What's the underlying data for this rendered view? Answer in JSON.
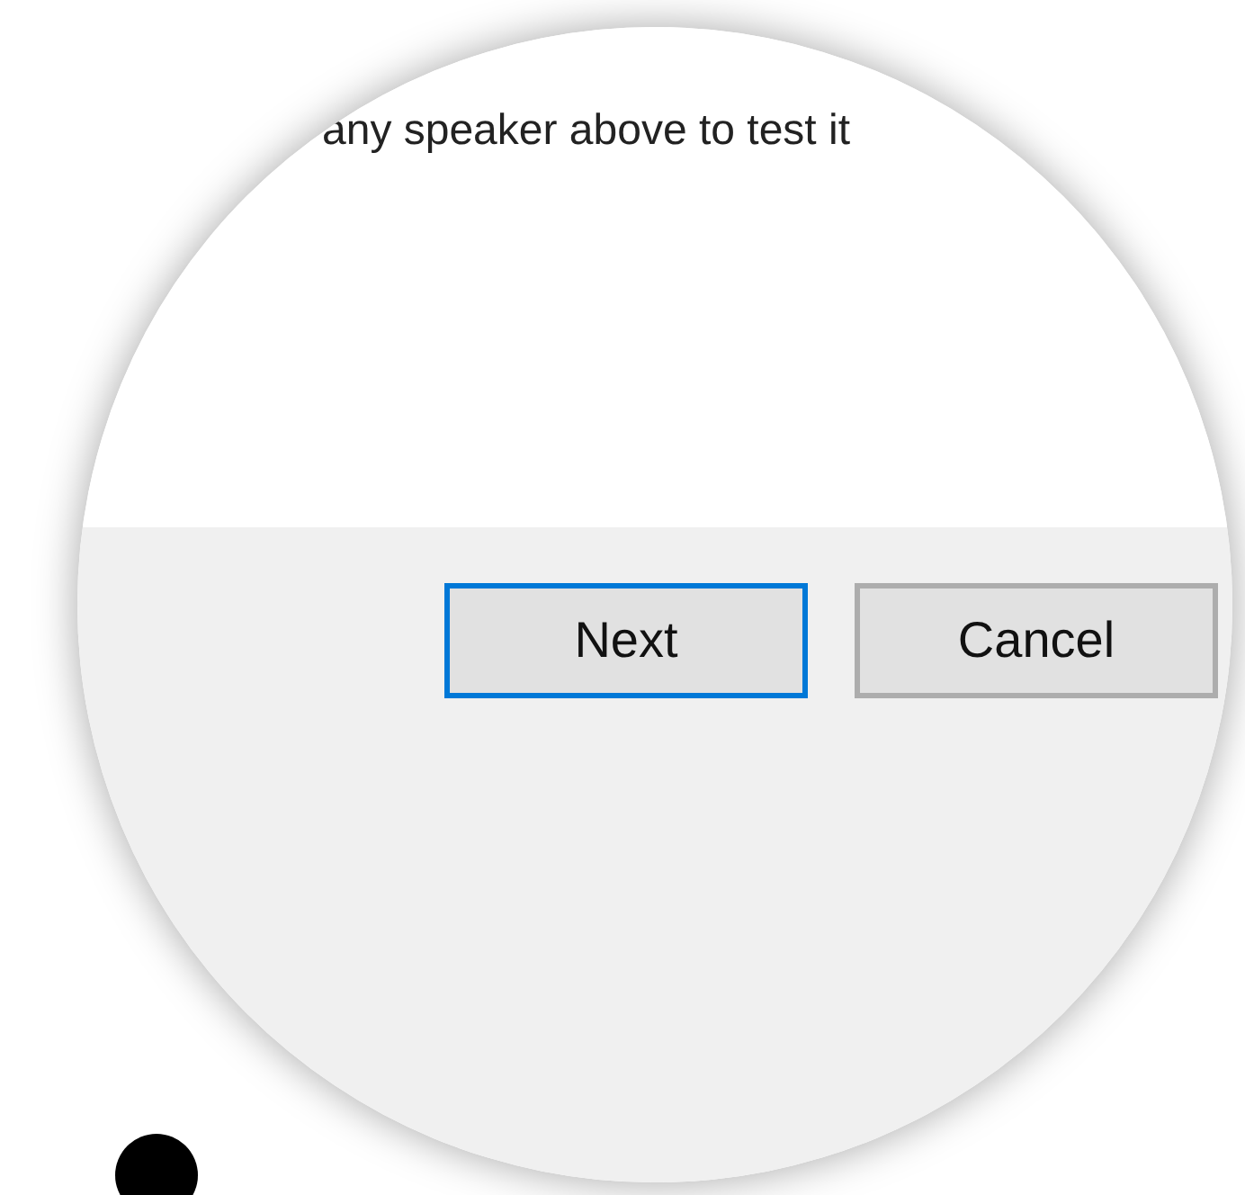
{
  "instruction": "any speaker above to test it",
  "buttons": [
    {
      "label": "Next",
      "default": true
    },
    {
      "label": "Cancel",
      "default": false
    }
  ]
}
